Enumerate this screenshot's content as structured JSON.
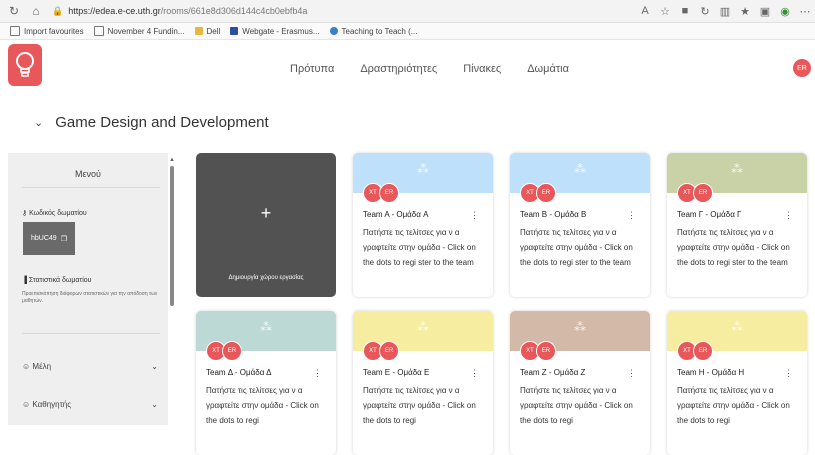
{
  "browser": {
    "url_host": "https://edea.e-ce.uth.gr",
    "url_path": "/rooms/661e8d306d144c4cb0ebfb4a",
    "bookmarks": [
      "Import favourites",
      "November 4 Fundin...",
      "Dell",
      "Webgate - Erasmus...",
      "Teaching to Teach (..."
    ]
  },
  "nav": {
    "items": [
      "Πρότυπα",
      "Δραστηριότητες",
      "Πίνακες",
      "Δωμάτια"
    ],
    "avatar": "ER"
  },
  "room": {
    "title": "Game Design and Development"
  },
  "sidebar": {
    "title": "Μενού",
    "code_label": "Κωδικός δωματίου",
    "code_value": "hbUC49",
    "stats_label": "Στατιστικά δωματίου",
    "stats_desc": "Προεπισκόπηση διάφορων στατιστικών για την απόδοση των μαθητών.",
    "members": "Μέλη",
    "teacher": "Καθηγητής"
  },
  "create_card": {
    "label": "Δημιουργία χώρου εργασίας",
    "plus": "+"
  },
  "teams": [
    {
      "name": "Team A - Ομάδα A",
      "color": "#bfe0fb",
      "avatars": [
        "XT",
        "ER"
      ],
      "desc": "Πατήστε τις τελίτσες για ν α γραφτείτε στην ομάδα - Click on the dots to regi ster to the team"
    },
    {
      "name": "Team B - Ομάδα B",
      "color": "#bfe0fb",
      "avatars": [
        "XT",
        "ER"
      ],
      "desc": "Πατήστε τις τελίτσες για ν α γραφτείτε στην ομάδα - Click on the dots to regi ster to the team"
    },
    {
      "name": "Team Γ - Ομάδα Γ",
      "color": "#c8d2a6",
      "avatars": [
        "XT",
        "ER"
      ],
      "desc": "Πατήστε τις τελίτσες για ν α γραφτείτε στην ομάδα - Click on the dots to regi ster to the team"
    },
    {
      "name": "Team Δ - Ομάδα Δ",
      "color": "#bcd9d5",
      "avatars": [
        "XT",
        "ER"
      ],
      "desc": "Πατήστε τις τελίτσες για ν α γραφτείτε στην ομάδα - Click on the dots to regi"
    },
    {
      "name": "Team E - Ομάδα E",
      "color": "#f7eda0",
      "avatars": [
        "XT",
        "ER"
      ],
      "desc": "Πατήστε τις τελίτσες για ν α γραφτείτε στην ομάδα - Click on the dots to regi"
    },
    {
      "name": "Team Z - Ομάδα Z",
      "color": "#d2b9a8",
      "avatars": [
        "XT",
        "ER"
      ],
      "desc": "Πατήστε τις τελίτσες για ν α γραφτείτε στην ομάδα - Click on the dots to regi"
    },
    {
      "name": "Team H - Ομάδα H",
      "color": "#f7eda0",
      "avatars": [
        "XT",
        "ER"
      ],
      "desc": "Πατήστε τις τελίτσες για ν α γραφτείτε στην ομάδα - Click on the dots to regi"
    }
  ],
  "colors": {
    "accent": "#e8575a",
    "create_bg": "#525252",
    "sidebar_bg": "#efefef"
  }
}
